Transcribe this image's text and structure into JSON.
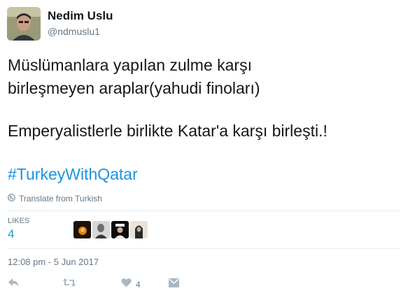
{
  "user": {
    "name": "Nedim Uslu",
    "handle": "@ndmuslu1"
  },
  "tweet": {
    "line1": "Müslümanlara yapılan zulme karşı",
    "line2": "birleşmeyen araplar(yahudi finoları)",
    "line3": "Emperyalistlerle birlikte Katar'a karşı birleşti.!",
    "hashtag": "#TurkeyWithQatar",
    "translate": "Translate from Turkish"
  },
  "likes": {
    "label": "LIKES",
    "count": "4"
  },
  "timestamp": "12:08 pm - 5 Jun 2017",
  "actions": {
    "like_count": "4"
  },
  "colors": {
    "link": "#1b95e0",
    "muted": "#657786",
    "icon": "#aab8c2"
  }
}
